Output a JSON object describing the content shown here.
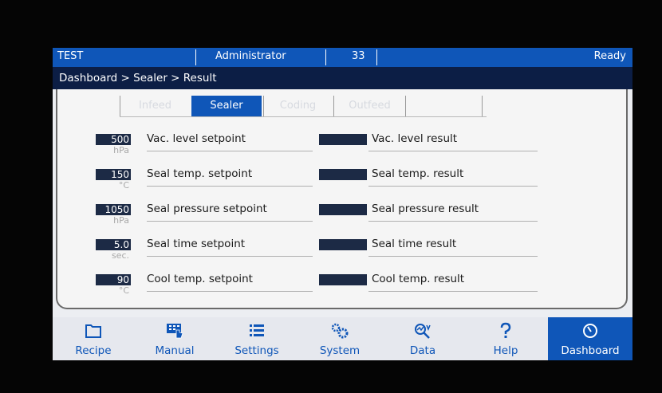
{
  "status": {
    "left": "TEST",
    "user": "Administrator",
    "count": "33",
    "right": "Ready"
  },
  "breadcrumb": "Dashboard > Sealer > Result",
  "tabs": [
    "Infeed",
    "Sealer",
    "Coding",
    "Outfeed"
  ],
  "rows": [
    {
      "value": "500",
      "unit": "hPa",
      "setpoint": "Vac. level setpoint",
      "result": "Vac. level result"
    },
    {
      "value": "150",
      "unit": "°C",
      "setpoint": "Seal temp. setpoint",
      "result": "Seal temp. result"
    },
    {
      "value": "1050",
      "unit": "hPa",
      "setpoint": "Seal pressure setpoint",
      "result": "Seal pressure result"
    },
    {
      "value": "5.0",
      "unit": "sec.",
      "setpoint": "Seal time setpoint",
      "result": "Seal time result"
    },
    {
      "value": "90",
      "unit": "°C",
      "setpoint": "Cool temp. setpoint",
      "result": "Cool temp. result"
    }
  ],
  "nav": [
    {
      "label": "Recipe",
      "icon": "folder-icon"
    },
    {
      "label": "Manual",
      "icon": "hand-keypad-icon"
    },
    {
      "label": "Settings",
      "icon": "list-icon"
    },
    {
      "label": "System",
      "icon": "gears-icon"
    },
    {
      "label": "Data",
      "icon": "search-chart-icon"
    },
    {
      "label": "Help",
      "icon": "question-icon"
    },
    {
      "label": "Dashboard",
      "icon": "gauge-icon"
    }
  ],
  "colors": {
    "accent": "#0f56b8",
    "header_dark": "#0c1e45",
    "value_box": "#1c2a45"
  }
}
